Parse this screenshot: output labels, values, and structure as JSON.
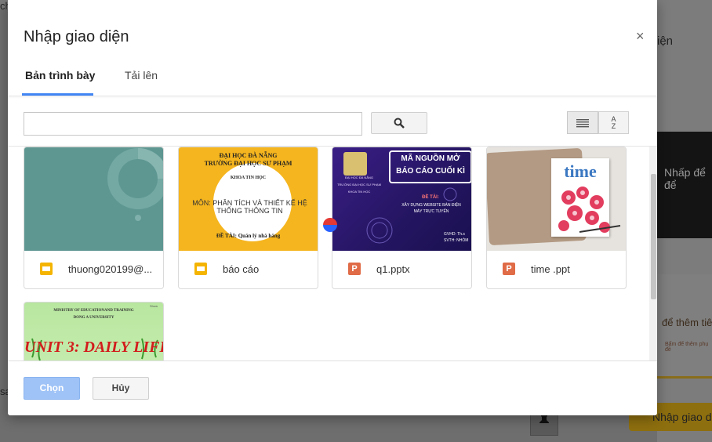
{
  "background": {
    "left_text_top": "ch",
    "left_text_bottom": "sa",
    "right_panel_title": "iện",
    "right_slide1_text": "Nhấp để\nđể",
    "right_slide2_text": "để thêm tiê",
    "right_slide2_subtext": "Bấm để thêm phụ đề",
    "right_button_label": "Nhập giao d"
  },
  "dialog": {
    "title": "Nhập giao diện",
    "close_glyph": "×",
    "tabs": [
      {
        "label": "Bản trình bày",
        "active": true
      },
      {
        "label": "Tải lên",
        "active": false
      }
    ],
    "search": {
      "value": "",
      "placeholder": ""
    },
    "sort_label_top": "A",
    "sort_label_bottom": "Z",
    "footer": {
      "select_label": "Chọn",
      "cancel_label": "Hủy"
    }
  },
  "files": [
    {
      "name": "thuong020199@...",
      "type": "slides",
      "icon": "google-slides-icon"
    },
    {
      "name": "báo cáo",
      "type": "slides",
      "icon": "google-slides-icon",
      "thumb": {
        "line1": "ĐẠI HỌC ĐÀ NẴNG",
        "line2": "TRƯỜNG ĐẠI HỌC SƯ PHẠM",
        "line3": "KHOA TIN HỌC",
        "line4": "MÔN: PHÂN TÍCH VÀ THIẾT KẾ HỆ THỐNG THÔNG TIN",
        "line5": "ĐỀ TÀI:  Quản lý nhà hàng"
      }
    },
    {
      "name": "q1.pptx",
      "type": "ppt",
      "icon": "powerpoint-icon",
      "icon_letter": "P",
      "thumb": {
        "title1": "MÃ NGUỒN MỞ",
        "title2": "BÁO CÁO CUỐI KÌ",
        "uni": "ĐẠI HỌC ĐÀ NẴNG",
        "school": "TRƯỜNG ĐẠI HỌC SƯ PHẠM",
        "dept": "KHOA TIN HỌC",
        "topic_label": "ĐỀ TÀI:",
        "topic": "XÂY DỰNG WEBSITE BÁN ĐIỆN MÁY TRỰC TUYẾN",
        "gvhd": "GVHD:  Th.s",
        "svth": "SVTH: NHÓM"
      }
    },
    {
      "name": "time .ppt",
      "type": "ppt",
      "icon": "powerpoint-icon",
      "icon_letter": "P",
      "thumb": {
        "word": "time"
      }
    },
    {
      "name": "",
      "type": "ppt",
      "thumb": {
        "line1": "MINISTRY OF EDUCATIONAND TRAINING",
        "line2": "DONG A UNIVERSITY",
        "title": "UNIT 3: DAILY LIFE",
        "tag": "Show"
      }
    }
  ],
  "colors": {
    "accent": "#4285f4",
    "slides_icon": "#f4b400",
    "ppt_icon": "#e06b47"
  }
}
